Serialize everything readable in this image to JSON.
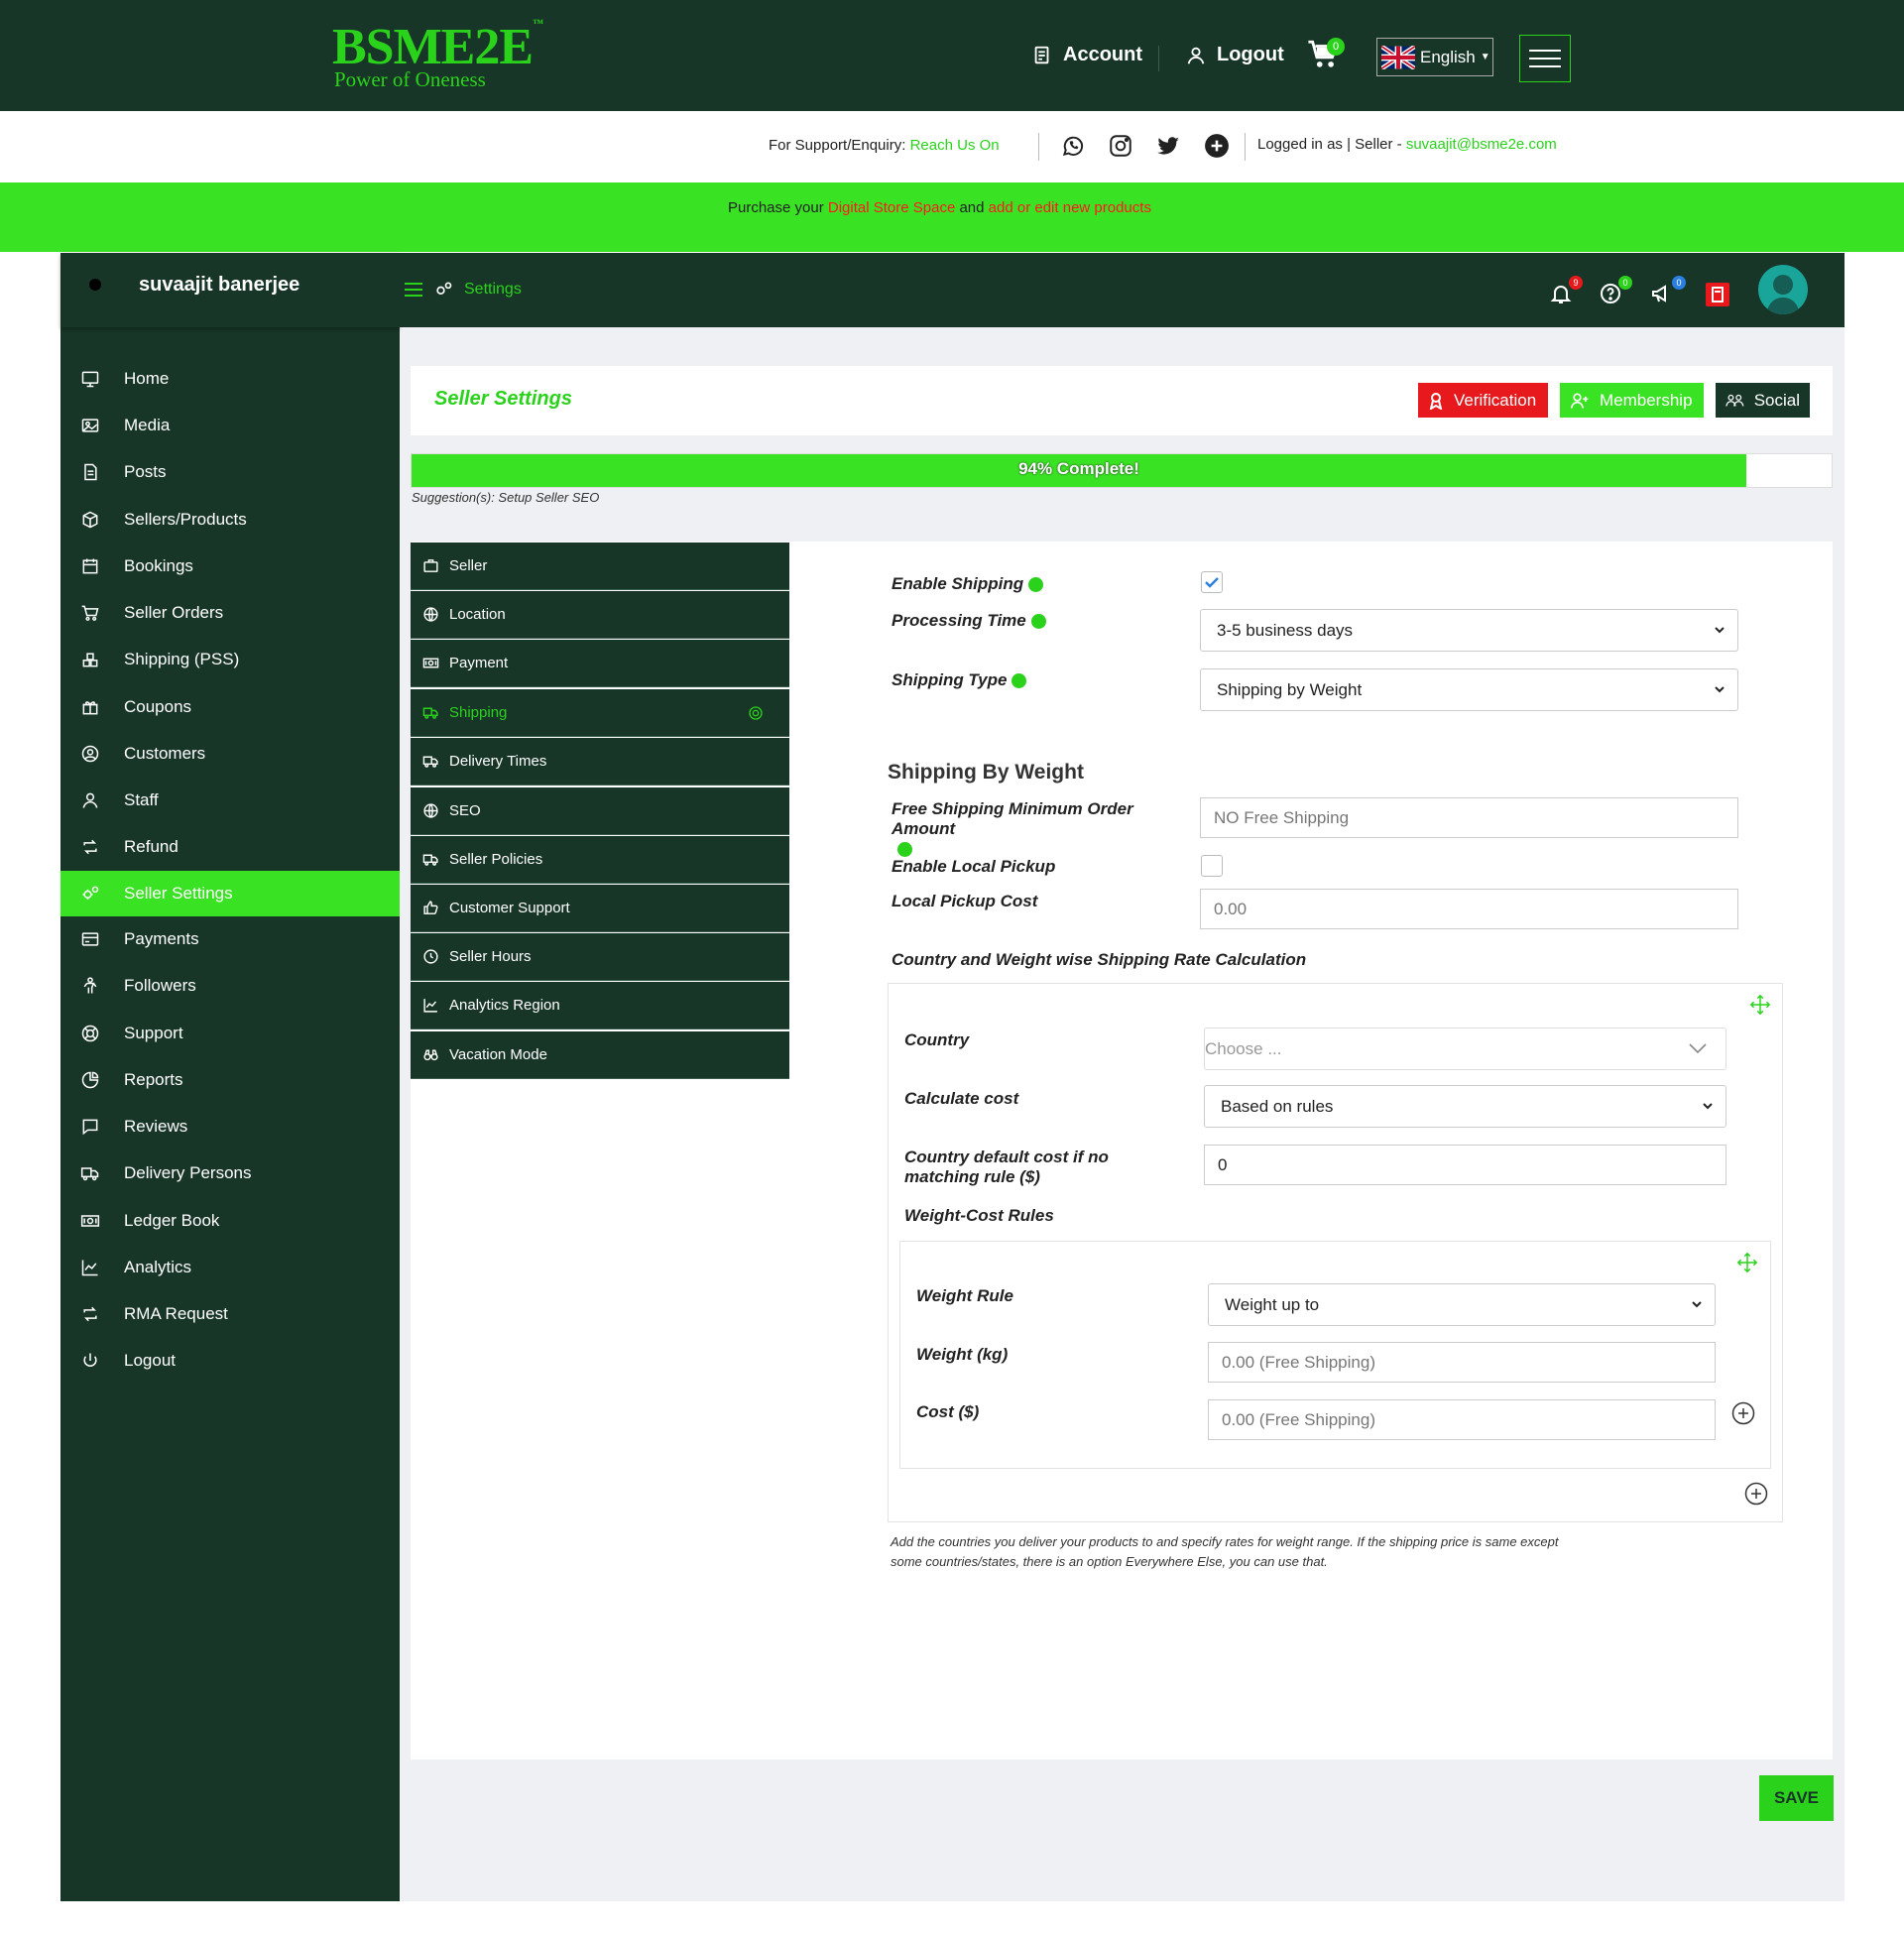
{
  "brand": {
    "name": "BSME2E",
    "tm": "™",
    "tagline": "Power of Oneness"
  },
  "topnav": {
    "account": "Account",
    "logout": "Logout",
    "cart_count": "0",
    "language": "English"
  },
  "support": {
    "prefix": "For Support/Enquiry:",
    "link": "Reach Us On",
    "logged_prefix": "Logged in as | Seller -",
    "email": "suvaajit@bsme2e.com"
  },
  "promo": {
    "prefix": "Purchase your",
    "link1": "Digital Store Space",
    "middle": "and",
    "link2": "add or edit new products"
  },
  "user": {
    "name": "suvaajit banerjee"
  },
  "header": {
    "crumb": "Settings",
    "notifications": "9",
    "help": "0",
    "announcements": "0"
  },
  "sidebar": {
    "items": [
      {
        "label": "Home",
        "icon": "monitor-icon"
      },
      {
        "label": "Media",
        "icon": "image-icon"
      },
      {
        "label": "Posts",
        "icon": "document-icon"
      },
      {
        "label": "Sellers/Products",
        "icon": "cube-icon"
      },
      {
        "label": "Bookings",
        "icon": "calendar-icon"
      },
      {
        "label": "Seller Orders",
        "icon": "cart-icon"
      },
      {
        "label": "Shipping (PSS)",
        "icon": "boxes-icon"
      },
      {
        "label": "Coupons",
        "icon": "gift-icon"
      },
      {
        "label": "Customers",
        "icon": "user-circle-icon"
      },
      {
        "label": "Staff",
        "icon": "user-icon"
      },
      {
        "label": "Refund",
        "icon": "retweet-icon"
      },
      {
        "label": "Seller Settings",
        "icon": "cogs-icon"
      },
      {
        "label": "Payments",
        "icon": "credit-card-icon"
      },
      {
        "label": "Followers",
        "icon": "child-icon"
      },
      {
        "label": "Support",
        "icon": "lifebuoy-icon"
      },
      {
        "label": "Reports",
        "icon": "pie-chart-icon"
      },
      {
        "label": "Reviews",
        "icon": "comment-icon"
      },
      {
        "label": "Delivery Persons",
        "icon": "truck-icon"
      },
      {
        "label": "Ledger Book",
        "icon": "money-icon"
      },
      {
        "label": "Analytics",
        "icon": "line-chart-icon"
      },
      {
        "label": "RMA Request",
        "icon": "retweet-icon"
      },
      {
        "label": "Logout",
        "icon": "power-icon"
      }
    ],
    "active_index": 11
  },
  "page": {
    "title": "Seller Settings",
    "verification": "Verification",
    "membership": "Membership",
    "social": "Social",
    "progress_label": "94% Complete!",
    "progress_fraction": 0.94,
    "suggestion": "Suggestion(s): Setup Seller SEO"
  },
  "tabs": [
    {
      "label": "Seller",
      "icon": "briefcase-icon"
    },
    {
      "label": "Location",
      "icon": "globe-icon"
    },
    {
      "label": "Payment",
      "icon": "money-icon"
    },
    {
      "label": "Shipping",
      "icon": "truck-icon"
    },
    {
      "label": "Delivery Times",
      "icon": "truck-icon"
    },
    {
      "label": "SEO",
      "icon": "globe-icon"
    },
    {
      "label": "Seller Policies",
      "icon": "truck-icon"
    },
    {
      "label": "Customer Support",
      "icon": "thumbs-up-icon"
    },
    {
      "label": "Seller Hours",
      "icon": "clock-icon"
    },
    {
      "label": "Analytics Region",
      "icon": "line-chart-icon"
    },
    {
      "label": "Vacation Mode",
      "icon": "binoculars-icon"
    }
  ],
  "shipping": {
    "enable_label": "Enable Shipping",
    "processing_label": "Processing Time",
    "processing_value": "3-5 business days",
    "type_label": "Shipping Type",
    "type_value": "Shipping by Weight",
    "section_heading": "Shipping By Weight",
    "free_min_label": "Free Shipping Minimum Order Amount",
    "free_min_placeholder": "NO Free Shipping",
    "local_pickup_label": "Enable Local Pickup",
    "local_cost_label": "Local Pickup Cost",
    "local_cost_placeholder": "0.00",
    "rate_heading": "Country and Weight wise Shipping Rate Calculation",
    "country_label": "Country",
    "country_placeholder": "Choose ...",
    "calc_label": "Calculate cost",
    "calc_value": "Based on rules",
    "default_cost_label": "Country default cost if no matching rule ($)",
    "default_cost_value": "0",
    "rules_heading": "Weight-Cost Rules",
    "weight_rule_label": "Weight Rule",
    "weight_rule_value": "Weight up to",
    "weight_label": "Weight (kg)",
    "weight_placeholder": "0.00 (Free Shipping)",
    "cost_label": "Cost ($)",
    "cost_placeholder": "0.00 (Free Shipping)",
    "note": "Add the countries you deliver your products to and specify rates for weight range. If the shipping price is same except some countries/states, there is an option Everywhere Else, you can use that."
  },
  "save_label": "SAVE",
  "colors": {
    "dark": "#183628",
    "green": "#2ad21c",
    "bright_green": "#3ae224",
    "red": "#e8191c"
  }
}
